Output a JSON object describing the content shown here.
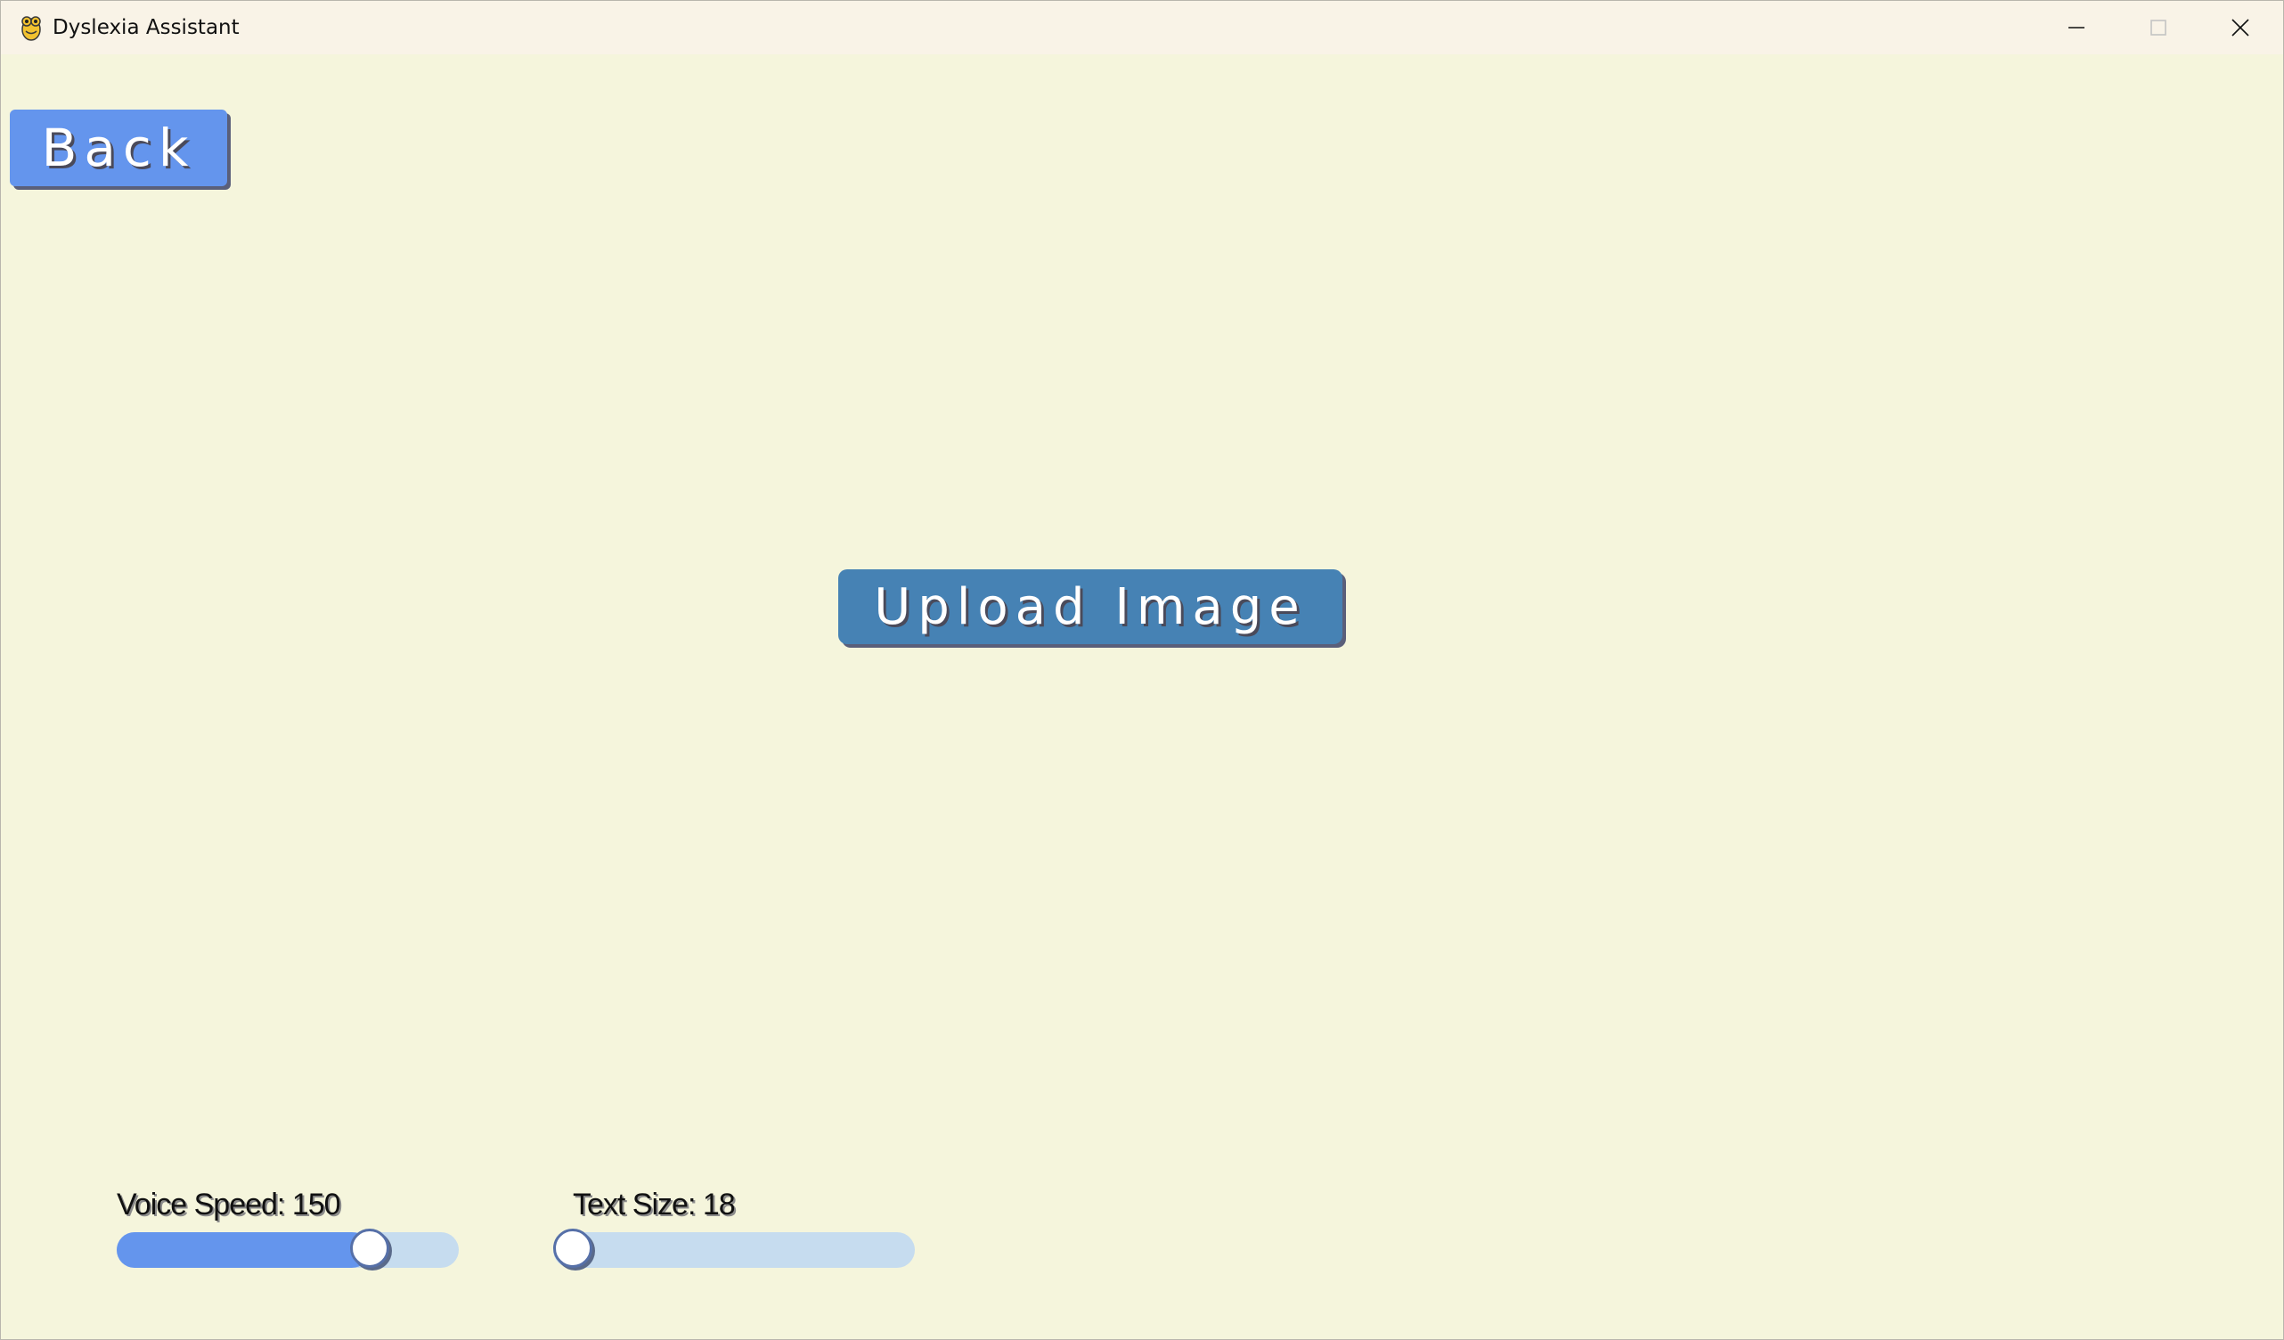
{
  "window": {
    "title": "Dyslexia Assistant",
    "icon": "pygame-snake-icon",
    "controls": [
      "minimize-icon",
      "maximize-icon",
      "close-icon"
    ]
  },
  "buttons": {
    "back_label": "Back",
    "upload_label": "Upload Image"
  },
  "sliders": {
    "voice_speed": {
      "label": "Voice Speed: 150",
      "value": 150,
      "fill_fraction": 0.74
    },
    "text_size": {
      "label": "Text Size: 18",
      "value": 18,
      "fill_fraction": 0.0
    }
  },
  "colors": {
    "background": "#f5f5dc",
    "titlebar": "#f9f3e7",
    "back_button": "#6495ed",
    "upload_button": "#4682b4",
    "slider_fill": "#6495ed",
    "slider_track": "#c6dcef"
  }
}
